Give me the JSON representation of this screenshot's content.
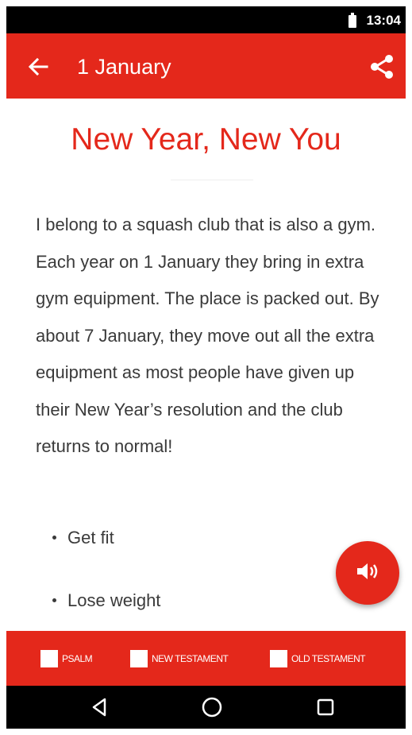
{
  "status_bar": {
    "time": "13:04",
    "icons": [
      "battery-icon"
    ]
  },
  "app_bar": {
    "title": "1 January",
    "icons": [
      "back-arrow-icon",
      "share-icon"
    ]
  },
  "devotion": {
    "title": "New Year, New You",
    "body": "I belong to a squash club that is also a gym. Each year on 1 January they bring in extra gym equipment. The place is packed out. By about 7 January, they move out all the extra equipment as most people have given up their New Year’s resolution and the club returns to normal!",
    "bullets": [
      "Get fit",
      "Lose weight"
    ]
  },
  "fab": {
    "icon": "speaker-icon"
  },
  "filters": [
    {
      "label": "PSALM",
      "checked": false
    },
    {
      "label": "NEW TESTAMENT",
      "checked": false
    },
    {
      "label": "OLD TESTAMENT",
      "checked": false
    }
  ],
  "nav": {
    "icons": [
      "back-triangle-icon",
      "home-circle-icon",
      "recents-square-icon"
    ]
  },
  "colors": {
    "accent": "#e4281b",
    "text": "#3a3a3a",
    "bars": "#000000"
  }
}
